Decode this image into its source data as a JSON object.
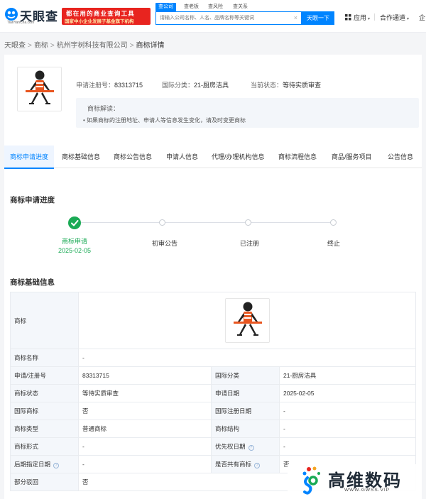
{
  "header": {
    "logo_text": "天眼查",
    "logo_sub": "TianYanCha.com",
    "promo_line1": "都在用的商业查询工具",
    "promo_line2": "国家中小企业发展子基金旗下机构",
    "search_tabs": [
      "查公司",
      "查老板",
      "查风险",
      "查关系"
    ],
    "search_placeholder": "请输入公司名称、人名、品牌名称等关键词",
    "search_button": "天眼一下",
    "app_menu": "应用",
    "partner_menu": "合作通道",
    "enterprise_menu": "企"
  },
  "breadcrumb": [
    "天眼查",
    "商标",
    "杭州宇树科技有限公司",
    "商标详情"
  ],
  "summary": {
    "reg_no_label": "申请注册号：",
    "reg_no": "83313715",
    "class_label": "国际分类：",
    "class_value": "21-厨房洁具",
    "status_label": "当前状态：",
    "status_value": "等待实质审查"
  },
  "note": {
    "title": "商标解读：",
    "text": "• 如果商标的注册地址、申请人等信息发生变化，请及时变更商标"
  },
  "tabs": [
    "商标申请进度",
    "商标基础信息",
    "商标公告信息",
    "申请人信息",
    "代理/办理机构信息",
    "商标流程信息",
    "商品/服务项目",
    "公告信息"
  ],
  "progress": {
    "title": "商标申请进度",
    "steps": [
      {
        "label": "商标申请",
        "date": "2025-02-05",
        "done": true
      },
      {
        "label": "初审公告",
        "date": "",
        "done": false
      },
      {
        "label": "已注册",
        "date": "",
        "done": false
      },
      {
        "label": "终止",
        "date": "",
        "done": false
      }
    ]
  },
  "basic": {
    "title": "商标基础信息",
    "trademark_label": "商标",
    "rows": [
      {
        "k1": "商标名称",
        "v1": "-",
        "k2": "",
        "v2": ""
      },
      {
        "k1": "申请/注册号",
        "v1": "83313715",
        "k2": "国际分类",
        "v2": "21-厨房洁具"
      },
      {
        "k1": "商标状态",
        "v1": "等待实质审查",
        "k2": "申请日期",
        "v2": "2025-02-05"
      },
      {
        "k1": "国际商标",
        "v1": "否",
        "k2": "国际注册日期",
        "v2": "-"
      },
      {
        "k1": "商标类型",
        "v1": "普通商标",
        "k2": "商标结构",
        "v2": "-"
      },
      {
        "k1": "商标形式",
        "v1": "-",
        "k2": "优先权日期",
        "v2": "-"
      },
      {
        "k1": "后期指定日期",
        "v1": "-",
        "k2": "是否共有商标",
        "v2": "否"
      },
      {
        "k1": "部分驳回",
        "v1": "否",
        "k2": "",
        "v2": ""
      }
    ]
  },
  "watermark": {
    "text": "高维数码",
    "sub": "WWW.GWSS.VIP"
  },
  "colors": {
    "brand_blue": "#0084ff",
    "promo_red": "#e8241f",
    "done_green": "#1aaa55",
    "table_key_bg": "#f4f7fb"
  }
}
